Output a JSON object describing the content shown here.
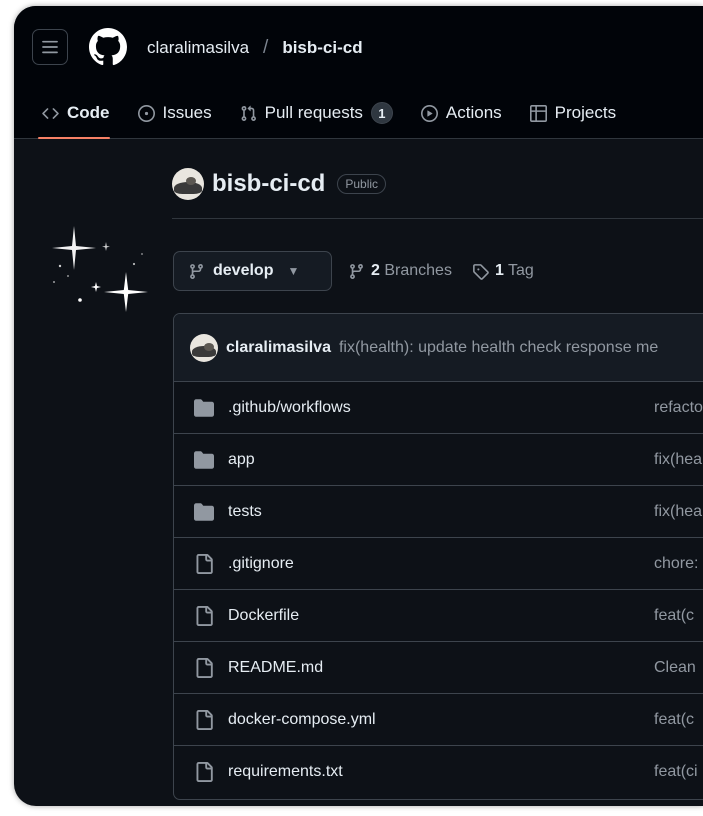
{
  "header": {
    "owner": "claralimasilva",
    "separator": "/",
    "repo": "bisb-ci-cd"
  },
  "tabs": [
    {
      "label": "Code",
      "icon": "code-icon",
      "active": true
    },
    {
      "label": "Issues",
      "icon": "issue-opened-icon"
    },
    {
      "label": "Pull requests",
      "icon": "git-pull-request-icon",
      "count": "1"
    },
    {
      "label": "Actions",
      "icon": "play-icon"
    },
    {
      "label": "Projects",
      "icon": "table-icon"
    }
  ],
  "repo_header": {
    "name": "bisb-ci-cd",
    "visibility": "Public"
  },
  "branch": {
    "current": "develop",
    "branches_count": "2",
    "branches_label": "Branches",
    "tags_count": "1",
    "tags_label": "Tag"
  },
  "latest_commit": {
    "author": "claralimasilva",
    "message": "fix(health): update health check response me"
  },
  "files": [
    {
      "name": ".github/workflows",
      "type": "folder",
      "commit": "refacto"
    },
    {
      "name": "app",
      "type": "folder",
      "commit": "fix(hea"
    },
    {
      "name": "tests",
      "type": "folder",
      "commit": "fix(hea"
    },
    {
      "name": ".gitignore",
      "type": "file",
      "commit": "chore:"
    },
    {
      "name": "Dockerfile",
      "type": "file",
      "commit": "feat(c"
    },
    {
      "name": "README.md",
      "type": "file",
      "commit": "Clean"
    },
    {
      "name": "docker-compose.yml",
      "type": "file",
      "commit": "feat(c"
    },
    {
      "name": "requirements.txt",
      "type": "file",
      "commit": "feat(ci"
    }
  ],
  "colors": {
    "background": "#0d1117",
    "header": "#010409",
    "border": "#3d444d",
    "text": "#e6edf3",
    "muted": "#9198a1",
    "active_tab_underline": "#f78166"
  }
}
